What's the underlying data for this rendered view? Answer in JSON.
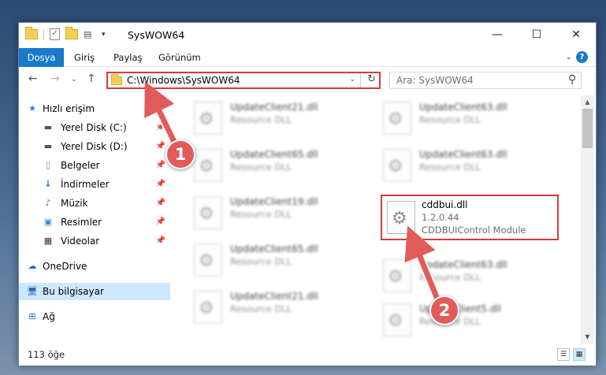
{
  "window": {
    "title": "SysWOW64",
    "minimize": "—",
    "maximize": "☐",
    "close": "✕"
  },
  "ribbon": {
    "tabs": [
      "Dosya",
      "Giriş",
      "Paylaş",
      "Görünüm"
    ],
    "help": "?"
  },
  "address": {
    "path": "C:\\Windows\\SysWOW64",
    "search_placeholder": "Ara: SysWOW64"
  },
  "nav_pane": {
    "items": [
      {
        "label": "Hızlı erişim",
        "icon": "star-icon",
        "pinned": false
      },
      {
        "label": "Yerel Disk (C:)",
        "icon": "drive-icon",
        "pinned": true
      },
      {
        "label": "Yerel Disk (D:)",
        "icon": "drive-icon",
        "pinned": true
      },
      {
        "label": "Belgeler",
        "icon": "documents-icon",
        "pinned": true
      },
      {
        "label": "İndirmeler",
        "icon": "download-icon",
        "pinned": true
      },
      {
        "label": "Müzik",
        "icon": "music-icon",
        "pinned": true
      },
      {
        "label": "Resimler",
        "icon": "pictures-icon",
        "pinned": true
      },
      {
        "label": "Videolar",
        "icon": "videos-icon",
        "pinned": true
      },
      {
        "label": "OneDrive",
        "icon": "cloud-icon",
        "pinned": false
      },
      {
        "label": "Bu bilgisayar",
        "icon": "computer-icon",
        "pinned": false,
        "selected": true
      },
      {
        "label": "Ağ",
        "icon": "network-icon",
        "pinned": false
      }
    ]
  },
  "files": {
    "left_column": [
      {
        "name": "UpdateClient21.dll",
        "desc": "Resource DLL"
      },
      {
        "name": "UpdateClient65.dll",
        "desc": "Resource DLL"
      },
      {
        "name": "UpdateClient19.dll",
        "desc": "Resource DLL"
      },
      {
        "name": "UpdateClient65.dll",
        "desc": "Resource DLL"
      },
      {
        "name": "UpdateClient21.dll",
        "desc": "Resource DLL"
      }
    ],
    "right_column": [
      {
        "name": "UpdateClient63.dll",
        "desc": "Resource DLL"
      },
      {
        "name": "UpdateClient63.dll",
        "desc": "Resource DLL"
      },
      {
        "name": "cddbui.dll",
        "version": "1.2.0.44",
        "desc": "CDDBUIControl Module",
        "highlighted": true
      },
      {
        "name": "UpdateClient63.dll",
        "desc": "Resource DLL"
      },
      {
        "name": "UpdateClient5.dll",
        "desc": "Resource DLL"
      }
    ]
  },
  "status": {
    "item_count": "113 öğe"
  },
  "annotations": {
    "step1": "1",
    "step2": "2",
    "accent": "#e15b5b"
  }
}
